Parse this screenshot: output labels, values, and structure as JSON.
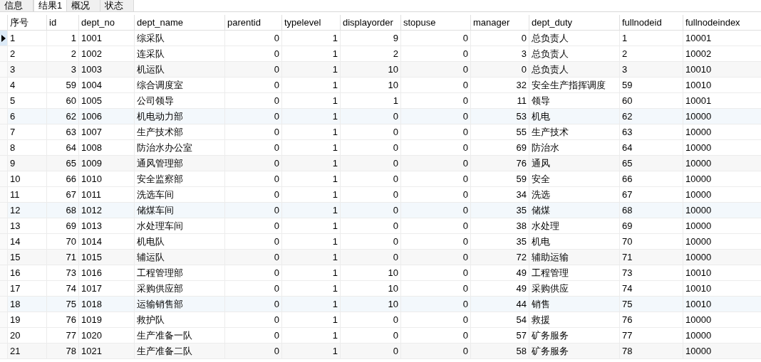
{
  "tabs": [
    {
      "label": "信息",
      "selected": false
    },
    {
      "label": "结果1",
      "selected": true
    },
    {
      "label": "概况",
      "selected": false
    },
    {
      "label": "状态",
      "selected": false
    }
  ],
  "table": {
    "columns": [
      {
        "label": "序号",
        "kind": "text"
      },
      {
        "label": "id",
        "kind": "number"
      },
      {
        "label": "dept_no",
        "kind": "text"
      },
      {
        "label": "dept_name",
        "kind": "text"
      },
      {
        "label": "parentid",
        "kind": "number"
      },
      {
        "label": "typelevel",
        "kind": "number"
      },
      {
        "label": "displayorder",
        "kind": "number"
      },
      {
        "label": "stopuse",
        "kind": "number"
      },
      {
        "label": "manager",
        "kind": "number"
      },
      {
        "label": "dept_duty",
        "kind": "text"
      },
      {
        "label": "fullnodeid",
        "kind": "text"
      },
      {
        "label": "fullnodeindex",
        "kind": "text"
      }
    ],
    "rows": [
      {
        "selected": true,
        "cells": [
          "1",
          "1",
          "1001",
          "综采队",
          "0",
          "1",
          "9",
          "0",
          "0",
          "总负责人",
          "1",
          "10001"
        ]
      },
      {
        "selected": false,
        "cells": [
          "2",
          "2",
          "1002",
          "连采队",
          "0",
          "1",
          "2",
          "0",
          "3",
          "总负责人",
          "2",
          "10002"
        ]
      },
      {
        "selected": false,
        "cells": [
          "3",
          "3",
          "1003",
          "机运队",
          "0",
          "1",
          "10",
          "0",
          "0",
          "总负责人",
          "3",
          "10010"
        ]
      },
      {
        "selected": false,
        "cells": [
          "4",
          "59",
          "1004",
          "综合调度室",
          "0",
          "1",
          "10",
          "0",
          "32",
          "安全生产指挥调度",
          "59",
          "10010"
        ]
      },
      {
        "selected": false,
        "cells": [
          "5",
          "60",
          "1005",
          "公司领导",
          "0",
          "1",
          "1",
          "0",
          "11",
          "领导",
          "60",
          "10001"
        ]
      },
      {
        "selected": false,
        "cells": [
          "6",
          "62",
          "1006",
          "机电动力部",
          "0",
          "1",
          "0",
          "0",
          "53",
          "机电",
          "62",
          "10000"
        ]
      },
      {
        "selected": false,
        "cells": [
          "7",
          "63",
          "1007",
          "生产技术部",
          "0",
          "1",
          "0",
          "0",
          "55",
          "生产技术",
          "63",
          "10000"
        ]
      },
      {
        "selected": false,
        "cells": [
          "8",
          "64",
          "1008",
          "防治水办公室",
          "0",
          "1",
          "0",
          "0",
          "69",
          "防治水",
          "64",
          "10000"
        ]
      },
      {
        "selected": false,
        "cells": [
          "9",
          "65",
          "1009",
          "通风管理部",
          "0",
          "1",
          "0",
          "0",
          "76",
          "通风",
          "65",
          "10000"
        ]
      },
      {
        "selected": false,
        "cells": [
          "10",
          "66",
          "1010",
          "安全监察部",
          "0",
          "1",
          "0",
          "0",
          "59",
          "安全",
          "66",
          "10000"
        ]
      },
      {
        "selected": false,
        "cells": [
          "11",
          "67",
          "1011",
          "洗选车间",
          "0",
          "1",
          "0",
          "0",
          "34",
          "洗选",
          "67",
          "10000"
        ]
      },
      {
        "selected": false,
        "cells": [
          "12",
          "68",
          "1012",
          "储煤车间",
          "0",
          "1",
          "0",
          "0",
          "35",
          "储煤",
          "68",
          "10000"
        ]
      },
      {
        "selected": false,
        "cells": [
          "13",
          "69",
          "1013",
          "水处理车间",
          "0",
          "1",
          "0",
          "0",
          "38",
          "水处理",
          "69",
          "10000"
        ]
      },
      {
        "selected": false,
        "cells": [
          "14",
          "70",
          "1014",
          "机电队",
          "0",
          "1",
          "0",
          "0",
          "35",
          "机电",
          "70",
          "10000"
        ]
      },
      {
        "selected": false,
        "cells": [
          "15",
          "71",
          "1015",
          "辅运队",
          "0",
          "1",
          "0",
          "0",
          "72",
          "辅助运输",
          "71",
          "10000"
        ]
      },
      {
        "selected": false,
        "cells": [
          "16",
          "73",
          "1016",
          "工程管理部",
          "0",
          "1",
          "10",
          "0",
          "49",
          "工程管理",
          "73",
          "10010"
        ]
      },
      {
        "selected": false,
        "cells": [
          "17",
          "74",
          "1017",
          "采购供应部",
          "0",
          "1",
          "10",
          "0",
          "49",
          "采购供应",
          "74",
          "10010"
        ]
      },
      {
        "selected": false,
        "cells": [
          "18",
          "75",
          "1018",
          "运输销售部",
          "0",
          "1",
          "10",
          "0",
          "44",
          "销售",
          "75",
          "10010"
        ]
      },
      {
        "selected": false,
        "cells": [
          "19",
          "76",
          "1019",
          "救护队",
          "0",
          "1",
          "0",
          "0",
          "54",
          "救援",
          "76",
          "10000"
        ]
      },
      {
        "selected": false,
        "cells": [
          "20",
          "77",
          "1020",
          "生产准备一队",
          "0",
          "1",
          "0",
          "0",
          "57",
          "矿务服务",
          "77",
          "10000"
        ]
      },
      {
        "selected": false,
        "cells": [
          "21",
          "78",
          "1021",
          "生产准备二队",
          "0",
          "1",
          "0",
          "0",
          "58",
          "矿务服务",
          "78",
          "10000"
        ]
      }
    ]
  }
}
